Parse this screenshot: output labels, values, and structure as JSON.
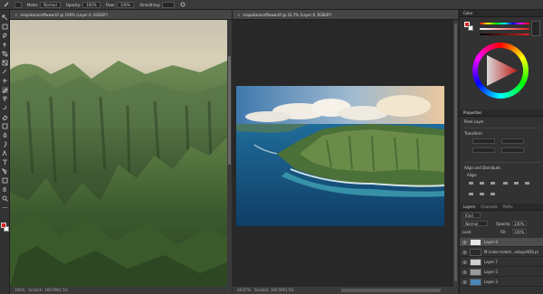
{
  "options_bar": {
    "mode_label": "Mode:",
    "mode_value": "Normal",
    "opacity_label": "Opacity:",
    "opacity_value": "100%",
    "flow_label": "Flow:",
    "flow_value": "100%",
    "smoothing_label": "Smoothing:"
  },
  "documents": [
    {
      "tab": "mapakanaroffwww.tif @ 100% (Layer 6, RGB/8*)",
      "zoom": "100%",
      "status": "Scratch: 160.5M/1.5G"
    },
    {
      "tab": "mapakanaroffwww.tif @ 16.7% (Layer 6, RGB/8*)",
      "zoom": "16.67%",
      "status": "Scratch: 160.5M/1.5G"
    }
  ],
  "panels": {
    "color_tab": "Color",
    "properties_tab": "Properties",
    "pixel_layer": "Pixel Layer",
    "transform": "Transform",
    "align_distribute": "Align and Distribute",
    "align_label": "Align:",
    "layers_tabs": [
      "Layers",
      "Channels",
      "Paths"
    ],
    "kind_label": "Kind",
    "blend_mode": "Normal",
    "opacity_label": "Opacity:",
    "opacity_value": "100%",
    "lock_label": "Lock:",
    "fill_label": "Fill:",
    "fill_value": "100%"
  },
  "layers": [
    {
      "name": "Layer 6",
      "selected": true
    },
    {
      "name": "M (color-match...setup)ADS.psd",
      "selected": false
    },
    {
      "name": "Layer 7",
      "selected": false
    },
    {
      "name": "Layer 5",
      "selected": false
    },
    {
      "name": "Layer 3",
      "selected": false
    }
  ],
  "colors": {
    "accent": "#1473e6",
    "foreground_swatch": "#e0211d",
    "background_swatch": "#ffffff"
  },
  "tools": [
    "move-icon",
    "marquee-icon",
    "lasso-icon",
    "quick-select-icon",
    "crop-icon",
    "frame-icon",
    "eyedropper-icon",
    "healing-icon",
    "brush-icon",
    "clone-stamp-icon",
    "history-brush-icon",
    "eraser-icon",
    "gradient-icon",
    "blur-icon",
    "dodge-icon",
    "pen-icon",
    "type-icon",
    "path-select-icon",
    "shape-icon",
    "hand-icon",
    "zoom-icon",
    "more-icon"
  ]
}
